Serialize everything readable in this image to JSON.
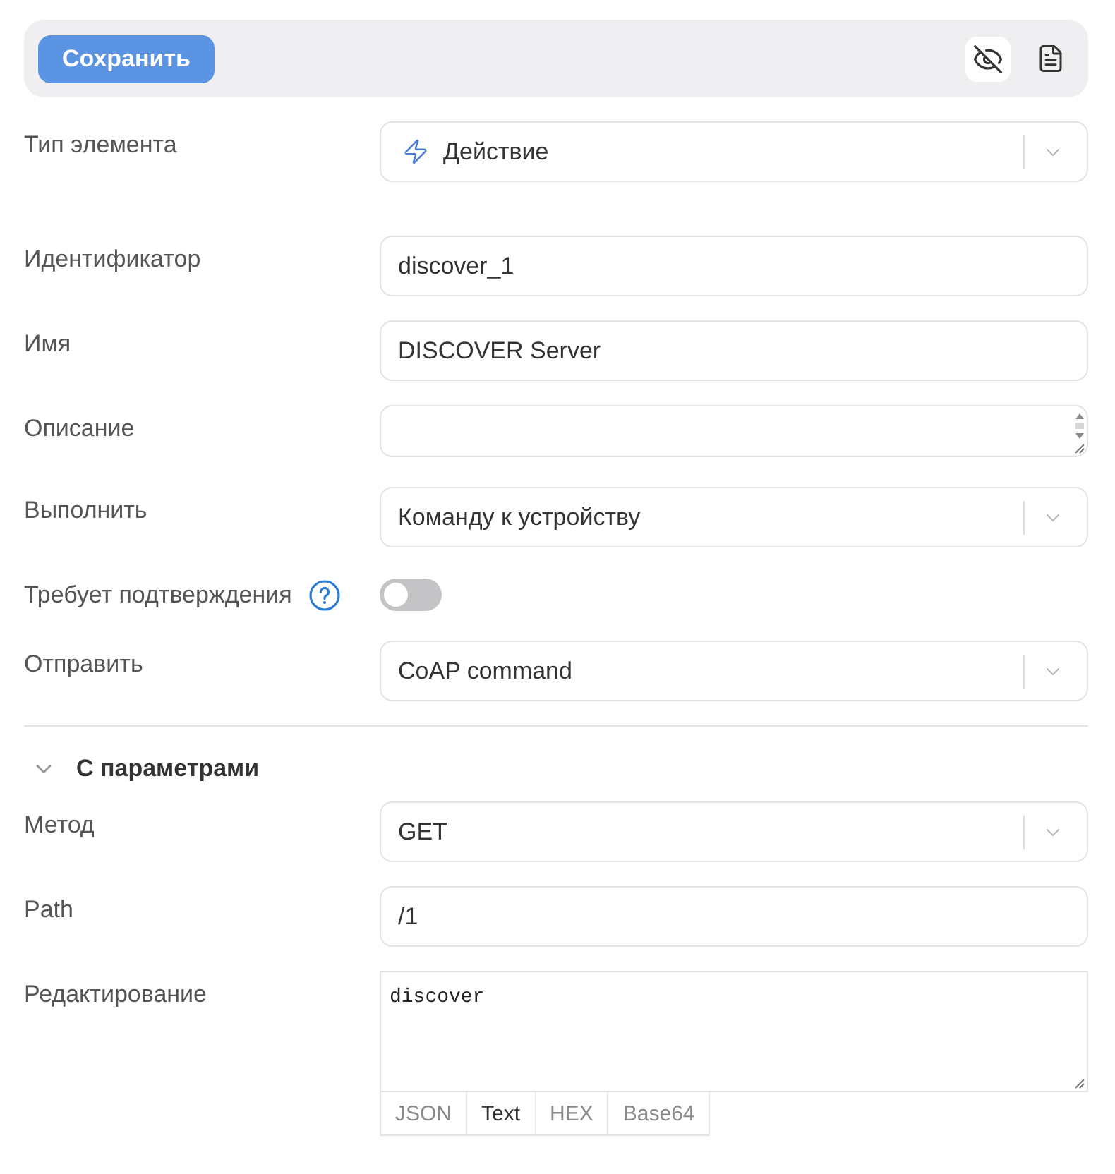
{
  "toolbar": {
    "save_button": {
      "label": "Сохранить",
      "disabled": true
    }
  },
  "fields": [
    {
      "kind": "icon-select",
      "label": "Тип элемента",
      "value": "Действие"
    },
    {
      "kind": "input",
      "label": "Идентификатор",
      "value": "discover_1"
    },
    {
      "kind": "input",
      "label": "Имя",
      "value": "DISCOVER Server"
    },
    {
      "kind": "textarea",
      "label": "Описание"
    },
    {
      "kind": "select",
      "label": "Выполнить",
      "value": "Команду к устройству"
    },
    {
      "kind": "toggle",
      "label": "Требует подтверждения",
      "on": false
    },
    {
      "kind": "select",
      "label": "Отправить",
      "value": "CoAP command"
    }
  ],
  "section": {
    "title": "С параметрами",
    "expanded": true,
    "fields": [
      {
        "kind": "select",
        "label": "Метод",
        "value": "GET"
      },
      {
        "kind": "input",
        "label": "Path",
        "value": "/1"
      },
      {
        "kind": "editor",
        "label": "Редактирование",
        "value": "discover",
        "tabs": [
          {
            "label": "JSON",
            "selected": false
          },
          {
            "label": "Text",
            "selected": true
          },
          {
            "label": "HEX",
            "selected": false
          },
          {
            "label": "Base64",
            "selected": false
          }
        ]
      }
    ]
  }
}
